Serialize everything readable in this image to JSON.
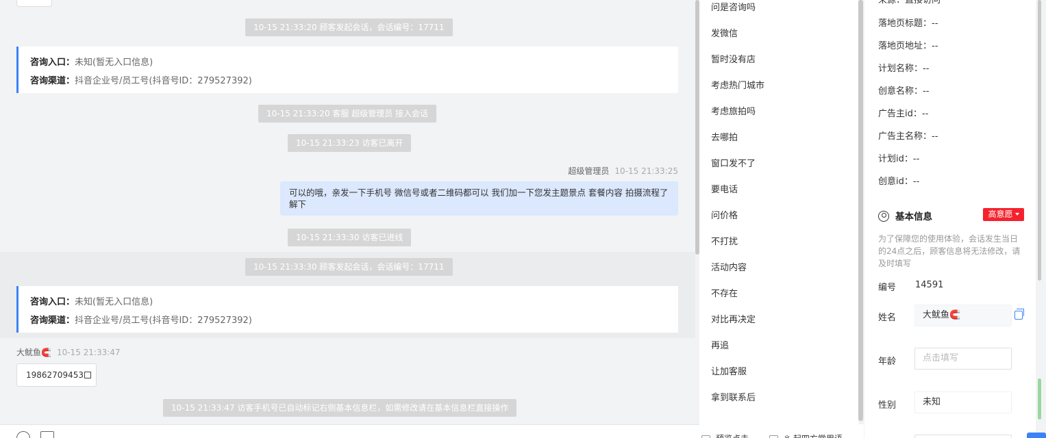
{
  "chat": {
    "messages": {
      "sys1": "10-15 21:33:20 顾客发起会话，会话编号：17711",
      "card1_entry_label": "咨询入口：",
      "card1_entry_value": "未知(暂无入口信息)",
      "card1_channel_label": "咨询渠道：",
      "card1_channel_value": "抖音企业号/员工号(抖音号ID：279527392)",
      "sys2": "10-15 21:33:20 客服 超级管理员 接入会话",
      "sys3": "10-15 21:33:23 访客已离开",
      "agent_name": "超级管理员",
      "agent_time": "10-15 21:33:25",
      "agent_msg": "可以的哦，亲发一下手机号 微信号或者二维码都可以 我们加一下您发主题景点 套餐内容 拍摄流程了解下",
      "sys4": "10-15 21:33:30 访客已进线",
      "sys5": "10-15 21:33:30 顾客发起会话，会话编号：17711",
      "card2_entry_label": "咨询入口：",
      "card2_entry_value": "未知(暂无入口信息)",
      "card2_channel_label": "咨询渠道：",
      "card2_channel_value": "抖音企业号/员工号(抖音号ID：279527392)",
      "visitor_name": "大鱿鱼🧲",
      "visitor_time": "10-15 21:33:47",
      "visitor_phone": "19862709453",
      "sys6": "10-15 21:33:47 访客手机号已自动标记右侧基本信息栏，如需修改请在基本信息栏直接操作"
    }
  },
  "quick_replies": [
    "问是咨询吗",
    "发微信",
    "暂时没有店",
    "考虑热门城市",
    "考虑旅拍吗",
    "去哪拍",
    "窗口发不了",
    "要电话",
    "问价格",
    "不打扰",
    "活动内容",
    "不存在",
    "对比再决定",
    "再追",
    "让加客服",
    "拿到联系后"
  ],
  "bottom_options": {
    "opt1": "预览点击",
    "opt2": "※ 起四方常用语"
  },
  "panel": {
    "source_partial": "来源：直接访问",
    "ad_info": [
      {
        "label": "落地页标题：",
        "value": "--"
      },
      {
        "label": "落地页地址：",
        "value": "--"
      },
      {
        "label": "计划名称：",
        "value": "--"
      },
      {
        "label": "创意名称：",
        "value": "--"
      },
      {
        "label": "广告主id：",
        "value": "--"
      },
      {
        "label": "广告主名称：",
        "value": "--"
      },
      {
        "label": "计划id：",
        "value": "--"
      },
      {
        "label": "创意id：",
        "value": "--"
      }
    ],
    "basic_title": "基本信息",
    "intent_badge": "高意愿",
    "notice": "为了保障您的使用体验，会话发生当日的24点之后，顾客信息将无法修改，请及时填写",
    "id_label": "编号",
    "id_value": "14591",
    "name_label": "姓名",
    "name_value": "大鱿鱼🧲",
    "age_label": "年龄",
    "age_placeholder": "点击填写",
    "gender_label": "性别",
    "gender_value": "未知"
  },
  "colors": {
    "accent": "#3b82f6",
    "badge": "#f5222d",
    "agent_bubble": "#dbe8fd",
    "system_pill": "#d6d6d6"
  }
}
